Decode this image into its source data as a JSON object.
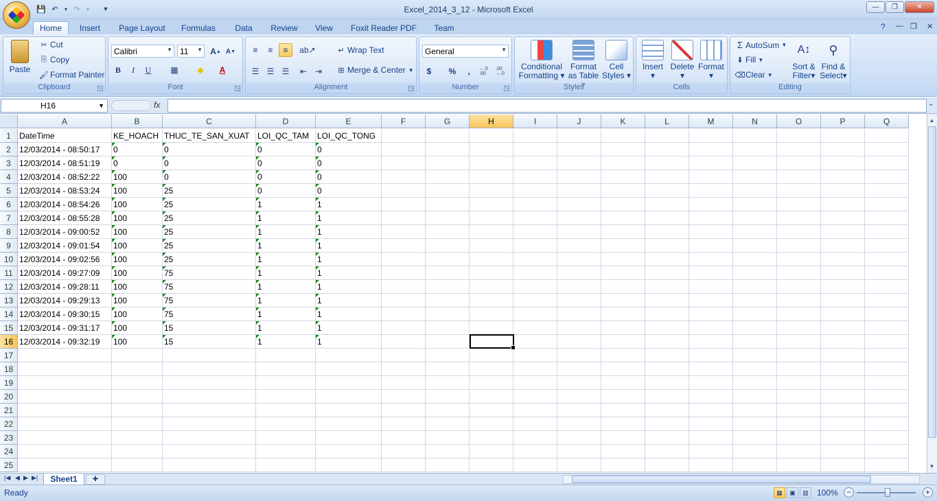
{
  "window": {
    "title": "Excel_2014_3_12 - Microsoft Excel",
    "minimize": "—",
    "restore": "❐",
    "close": "✕"
  },
  "tabs": [
    "Home",
    "Insert",
    "Page Layout",
    "Formulas",
    "Data",
    "Review",
    "View",
    "Foxit Reader PDF",
    "Team"
  ],
  "active_tab": "Home",
  "ribbon": {
    "clipboard": {
      "label": "Clipboard",
      "paste": "Paste",
      "cut": "Cut",
      "copy": "Copy",
      "format_painter": "Format Painter"
    },
    "font": {
      "label": "Font",
      "name": "Calibri",
      "size": "11",
      "bold": "B",
      "italic": "I",
      "underline": "U",
      "grow": "A",
      "shrink": "A"
    },
    "alignment": {
      "label": "Alignment",
      "wrap_text": "Wrap Text",
      "merge_center": "Merge & Center"
    },
    "number": {
      "label": "Number",
      "format": "General",
      "currency": "$",
      "percent": "%",
      "comma": ",",
      "inc_dec": "←.0 .00",
      "dec_dec": ".00 →.0"
    },
    "styles": {
      "label": "Styles",
      "conditional": [
        "Conditional",
        "Formatting"
      ],
      "format_table": [
        "Format",
        "as Table"
      ],
      "cell_styles": [
        "Cell",
        "Styles"
      ]
    },
    "cells": {
      "label": "Cells",
      "insert": "Insert",
      "delete": "Delete",
      "format": "Format"
    },
    "editing": {
      "label": "Editing",
      "autosum": "AutoSum",
      "fill": "Fill",
      "clear": "Clear",
      "sort_filter": [
        "Sort &",
        "Filter"
      ],
      "find_select": [
        "Find &",
        "Select"
      ]
    }
  },
  "formula_bar": {
    "name_box": "H16",
    "fx": "fx",
    "value": ""
  },
  "columns": [
    "A",
    "B",
    "C",
    "D",
    "E",
    "F",
    "G",
    "H",
    "I",
    "J",
    "K",
    "L",
    "M",
    "N",
    "O",
    "P",
    "Q"
  ],
  "selected_column": "H",
  "rows": [
    "1",
    "2",
    "3",
    "4",
    "5",
    "6",
    "7",
    "8",
    "9",
    "10",
    "11",
    "12",
    "13",
    "14",
    "15",
    "16",
    "17",
    "18",
    "19",
    "20",
    "21",
    "22",
    "23",
    "24",
    "25"
  ],
  "selected_row": "16",
  "sheet": {
    "headers": [
      "DateTime",
      "KE_HOACH",
      "THUC_TE_SAN_XUAT",
      "LOI_QC_TAM",
      "LOI_QC_TONG"
    ],
    "data": [
      [
        "12/03/2014 - 08:50:17",
        "0",
        "0",
        "0",
        "0"
      ],
      [
        "12/03/2014 - 08:51:19",
        "0",
        "0",
        "0",
        "0"
      ],
      [
        "12/03/2014 - 08:52:22",
        "100",
        "0",
        "0",
        "0"
      ],
      [
        "12/03/2014 - 08:53:24",
        "100",
        "25",
        "0",
        "0"
      ],
      [
        "12/03/2014 - 08:54:26",
        "100",
        "25",
        "1",
        "1"
      ],
      [
        "12/03/2014 - 08:55:28",
        "100",
        "25",
        "1",
        "1"
      ],
      [
        "12/03/2014 - 09:00:52",
        "100",
        "25",
        "1",
        "1"
      ],
      [
        "12/03/2014 - 09:01:54",
        "100",
        "25",
        "1",
        "1"
      ],
      [
        "12/03/2014 - 09:02:56",
        "100",
        "25",
        "1",
        "1"
      ],
      [
        "12/03/2014 - 09:27:09",
        "100",
        "75",
        "1",
        "1"
      ],
      [
        "12/03/2014 - 09:28:11",
        "100",
        "75",
        "1",
        "1"
      ],
      [
        "12/03/2014 - 09:29:13",
        "100",
        "75",
        "1",
        "1"
      ],
      [
        "12/03/2014 - 09:30:15",
        "100",
        "75",
        "1",
        "1"
      ],
      [
        "12/03/2014 - 09:31:17",
        "100",
        "15",
        "1",
        "1"
      ],
      [
        "12/03/2014 - 09:32:19",
        "100",
        "15",
        "1",
        "1"
      ]
    ]
  },
  "sheet_tabs": [
    "Sheet1"
  ],
  "status": {
    "text": "Ready",
    "zoom": "100%"
  }
}
